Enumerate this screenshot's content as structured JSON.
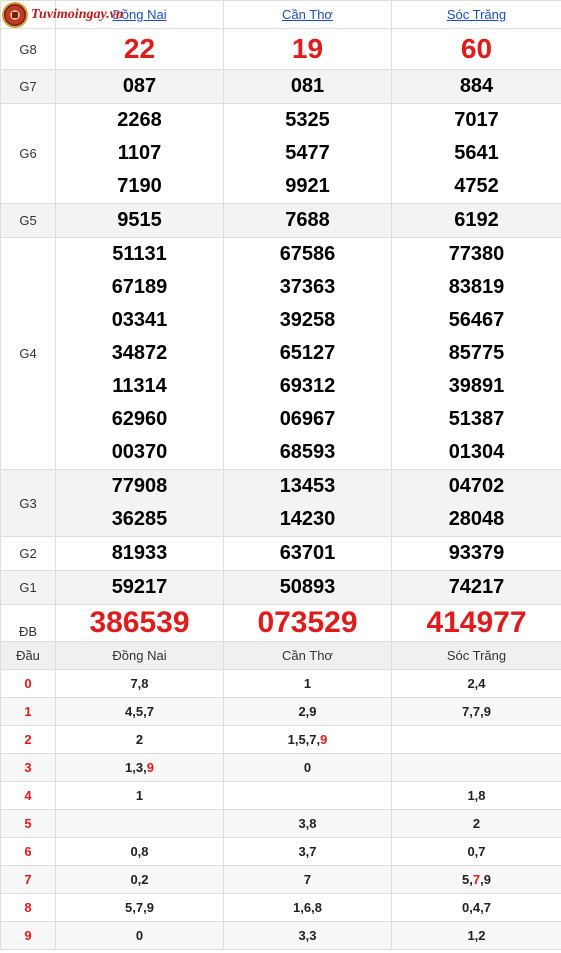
{
  "logo": {
    "text": "Tuvimoingay.vn"
  },
  "provinces": [
    "Đồng Nai",
    "Cần Thơ",
    "Sóc Trăng"
  ],
  "prizes": [
    {
      "label": "G8",
      "values": [
        [
          "22"
        ],
        [
          "19"
        ],
        [
          "60"
        ]
      ]
    },
    {
      "label": "G7",
      "values": [
        [
          "087"
        ],
        [
          "081"
        ],
        [
          "884"
        ]
      ]
    },
    {
      "label": "G6",
      "values": [
        [
          "2268",
          "1107",
          "7190"
        ],
        [
          "5325",
          "5477",
          "9921"
        ],
        [
          "7017",
          "5641",
          "4752"
        ]
      ]
    },
    {
      "label": "G5",
      "values": [
        [
          "9515"
        ],
        [
          "7688"
        ],
        [
          "6192"
        ]
      ]
    },
    {
      "label": "G4",
      "values": [
        [
          "51131",
          "67189",
          "03341",
          "34872",
          "11314",
          "62960",
          "00370"
        ],
        [
          "67586",
          "37363",
          "39258",
          "65127",
          "69312",
          "06967",
          "68593"
        ],
        [
          "77380",
          "83819",
          "56467",
          "85775",
          "39891",
          "51387",
          "01304"
        ]
      ]
    },
    {
      "label": "G3",
      "values": [
        [
          "77908",
          "36285"
        ],
        [
          "13453",
          "14230"
        ],
        [
          "04702",
          "28048"
        ]
      ]
    },
    {
      "label": "G2",
      "values": [
        [
          "81933"
        ],
        [
          "63701"
        ],
        [
          "93379"
        ]
      ]
    },
    {
      "label": "G1",
      "values": [
        [
          "59217"
        ],
        [
          "50893"
        ],
        [
          "74217"
        ]
      ]
    },
    {
      "label": "ĐB",
      "values": [
        [
          "386539"
        ],
        [
          "073529"
        ],
        [
          "414977"
        ]
      ]
    }
  ],
  "dau_header": "Đầu",
  "dau_rows": [
    {
      "head": "0",
      "cells": [
        "7,8",
        "1",
        "2,4"
      ]
    },
    {
      "head": "1",
      "cells": [
        "4,5,7",
        "2,9",
        "7,7,9"
      ]
    },
    {
      "head": "2",
      "cells": [
        "2",
        "1,5,7,9",
        ""
      ]
    },
    {
      "head": "3",
      "cells": [
        "1,3,9",
        "0",
        ""
      ]
    },
    {
      "head": "4",
      "cells": [
        "1",
        "",
        "1,8"
      ]
    },
    {
      "head": "5",
      "cells": [
        "",
        "3,8",
        "2"
      ]
    },
    {
      "head": "6",
      "cells": [
        "0,8",
        "3,7",
        "0,7"
      ]
    },
    {
      "head": "7",
      "cells": [
        "0,2",
        "7",
        "5,7,9"
      ]
    },
    {
      "head": "8",
      "cells": [
        "5,7,9",
        "1,6,8",
        "0,4,7"
      ]
    },
    {
      "head": "9",
      "cells": [
        "0",
        "3,3",
        "1,2"
      ]
    }
  ],
  "highlight_color": "#e01b1b",
  "link_color": "#1a4fbf"
}
